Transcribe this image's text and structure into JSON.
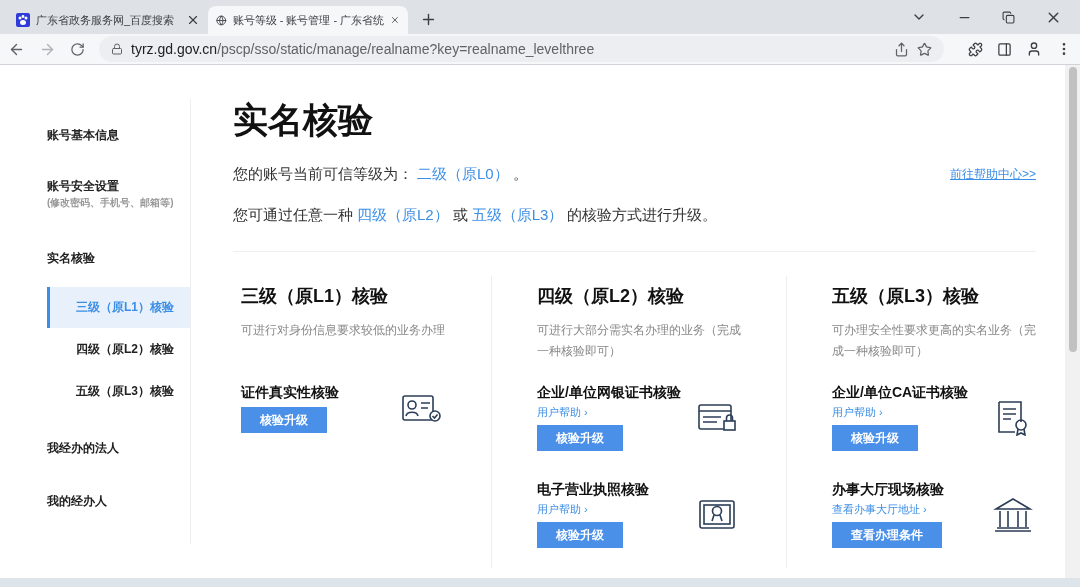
{
  "browser": {
    "tabs": [
      {
        "title": "广东省政务服务网_百度搜索",
        "kind": "paw",
        "selected": false
      },
      {
        "title": "账号等级 - 账号管理 - 广东省统",
        "kind": "globe",
        "selected": true
      }
    ],
    "url": {
      "host": "tyrz.gd.gov.cn",
      "path": "/pscp/sso/static/manage/realname?key=realname_levelthree"
    }
  },
  "sidebar": {
    "items": [
      {
        "label": "账号基本信息",
        "selected": false
      },
      {
        "label": "账号安全设置",
        "note": "(修改密码、手机号、邮箱等)",
        "selected": false
      },
      {
        "label": "实名核验",
        "selected": false,
        "children": [
          {
            "label": "三级（原L1）核验",
            "selected": true
          },
          {
            "label": "四级（原L2）核验",
            "selected": false
          },
          {
            "label": "五级（原L3）核验",
            "selected": false
          }
        ]
      },
      {
        "label": "我经办的法人",
        "selected": false
      },
      {
        "label": "我的经办人",
        "selected": false
      }
    ]
  },
  "main": {
    "title": "实名核验",
    "current_level": {
      "text": "您的账号当前可信等级为：",
      "level": "二级（原L0）",
      "suffix": "。"
    },
    "help_center": "前往帮助中心>>",
    "upgrade": {
      "prefix": "您可通过任意一种",
      "option_1": "四级（原L2）",
      "joiner": "或",
      "option_2": "五级（原L3）",
      "suffix": "的核验方式进行升级。"
    },
    "levels": [
      {
        "title": "三级（原L1）核验",
        "description": "可进行对身份信息要求较低的业务办理",
        "methods": [
          {
            "name": "证件真实性核验",
            "kind": "id-card",
            "button": "核验升级"
          }
        ]
      },
      {
        "title": "四级（原L2）核验",
        "description": "可进行大部分需实名办理的业务（完成一种核验即可）",
        "methods": [
          {
            "name": "企业/单位网银证书核验",
            "kind": "bank-card",
            "help": "用户帮助 ›",
            "button": "核验升级"
          },
          {
            "name": "电子营业执照核验",
            "kind": "license",
            "help": "用户帮助 ›",
            "button": "核验升级"
          }
        ]
      },
      {
        "title": "五级（原L3）核验",
        "description": "可办理安全性要求更高的实名业务（完成一种核验即可）",
        "methods": [
          {
            "name": "企业/单位CA证书核验",
            "kind": "certificate",
            "help": "用户帮助 ›",
            "button": "核验升级"
          },
          {
            "name": "办事大厅现场核验",
            "kind": "building",
            "help": "查看办事大厅地址 ›",
            "button": "查看办理条件"
          }
        ]
      }
    ]
  }
}
